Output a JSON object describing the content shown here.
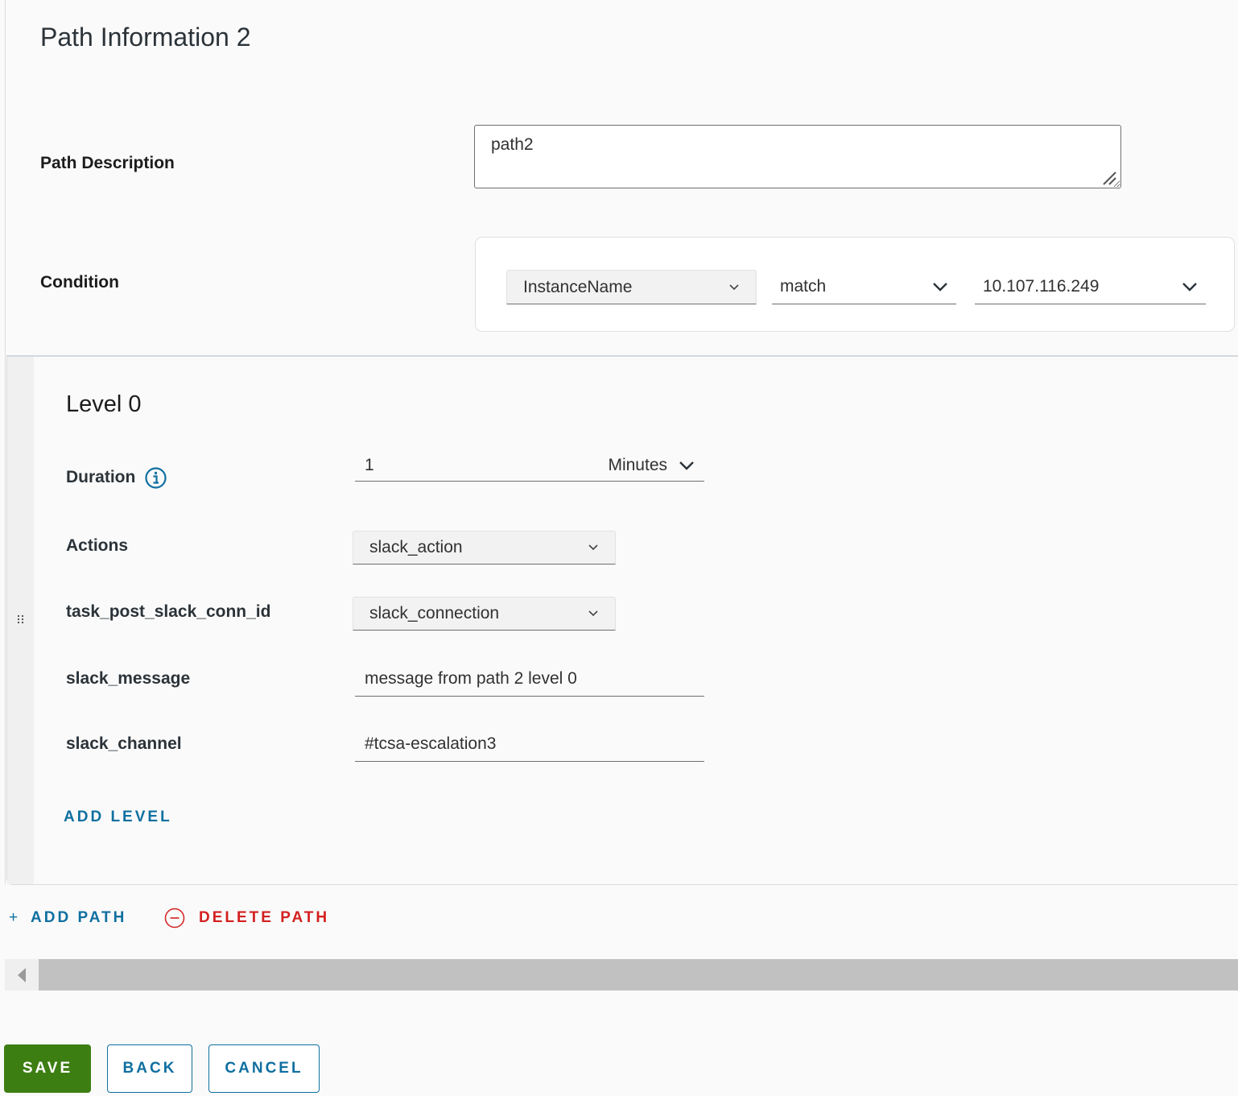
{
  "page": {
    "title": "Path Information 2"
  },
  "path_description": {
    "label": "Path Description",
    "value": "path2"
  },
  "condition": {
    "label": "Condition",
    "field": "InstanceName",
    "operator": "match",
    "value": "10.107.116.249"
  },
  "level": {
    "title": "Level 0",
    "duration": {
      "label": "Duration",
      "value": "1",
      "unit": "Minutes"
    },
    "actions": {
      "label": "Actions",
      "value": "slack_action"
    },
    "conn_id": {
      "label": "task_post_slack_conn_id",
      "value": "slack_connection"
    },
    "slack_message": {
      "label": "slack_message",
      "value": "message from path 2 level 0"
    },
    "slack_channel": {
      "label": "slack_channel",
      "value": "#tcsa-escalation3"
    },
    "add_level_label": "ADD LEVEL"
  },
  "path_actions": {
    "add_path_icon": "+",
    "add_path_label": "ADD PATH",
    "delete_path_label": "DELETE PATH"
  },
  "footer": {
    "save_label": "SAVE",
    "back_label": "BACK",
    "cancel_label": "CANCEL"
  },
  "colors": {
    "accent": "#0f6fa0",
    "primary_button": "#3d7e13",
    "danger": "#d32020"
  }
}
